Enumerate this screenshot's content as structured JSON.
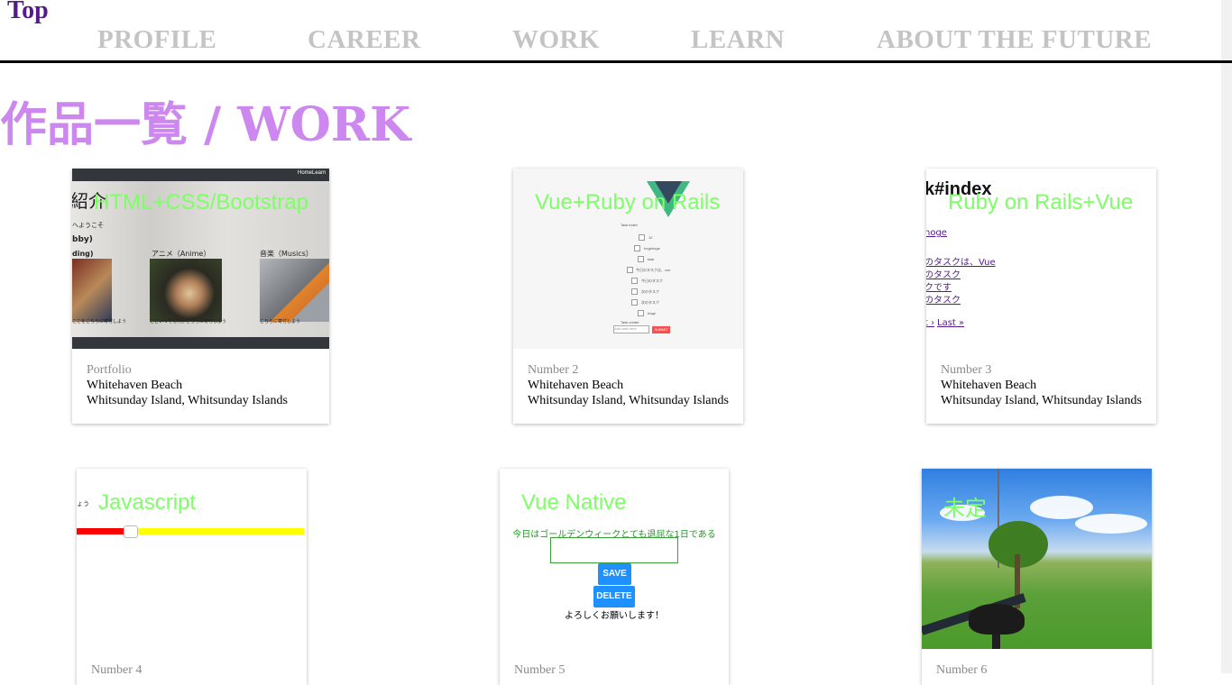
{
  "header": {
    "top_link": "Top",
    "nav": [
      "PROFILE",
      "CAREER",
      "WORK",
      "LEARN",
      "ABOUT THE FUTURE"
    ]
  },
  "page_title": "作品一覧 / WORK",
  "colors": {
    "title": "#cc88ee",
    "nav": "#c4c4c4",
    "top_link": "#551a8b",
    "overlay": "#7dff66"
  },
  "cards": [
    {
      "overlay": "HTML+CSS/Bootstrap",
      "subtitle": "Portfolio",
      "line1": "Whitehaven Beach",
      "line2": "Whitsunday Island, Whitsunday Islands",
      "shot": {
        "menu": [
          "Home",
          "Learn"
        ],
        "heading": "紹介",
        "sub": "へようこそ",
        "hobby": "bby)",
        "ding": "ding)",
        "anime": "アニメ（Anime）",
        "music": "音楽（Musics）",
        "cap1": "ここをこちらに寄付しよう",
        "cap2": "ここいつでも何かこちらに寄付しよう",
        "cap3": "こちらに寄付しよう"
      }
    },
    {
      "overlay": "Vue+Ruby on Rails",
      "subtitle": "Number 2",
      "line1": "Whitehaven Beach",
      "line2": "Whitsunday Island, Whitsunday Islands",
      "shot": {
        "list_title": "Task index",
        "items": [
          "12",
          "hogehoge",
          "task",
          "今日のタスクは、vue",
          "今日のタスク",
          "次のタスク",
          "次のタスク",
          "hoge"
        ],
        "form_title": "Task create",
        "placeholder": "Add task here",
        "submit": "SUBMIT"
      }
    },
    {
      "overlay": "Ruby on Rails+Vue",
      "subtitle": "Number 3",
      "line1": "Whitehaven Beach",
      "line2": "Whitsunday Island, Whitsunday Islands",
      "shot": {
        "heading": "k#index",
        "links": [
          "hoge",
          "のタスクは、Vue",
          "のタスク",
          "クです",
          "のタスク"
        ],
        "pager_prev": "t ›",
        "pager_last": "Last »"
      }
    },
    {
      "overlay": "Javascript",
      "subtitle": "Number 4",
      "line1": "",
      "line2": "",
      "shot": {
        "tiny": "ょう"
      }
    },
    {
      "overlay": "Vue Native",
      "subtitle": "Number 5",
      "line1": "",
      "line2": "",
      "shot": {
        "message": "今日はゴールデンウィークとても退屈な1日である",
        "save": "SAVE",
        "delete": "DELETE",
        "thanks": "よろしくお願いします！"
      }
    },
    {
      "overlay": "未定",
      "subtitle": "Number 6",
      "line1": "",
      "line2": "",
      "shot": {}
    }
  ]
}
